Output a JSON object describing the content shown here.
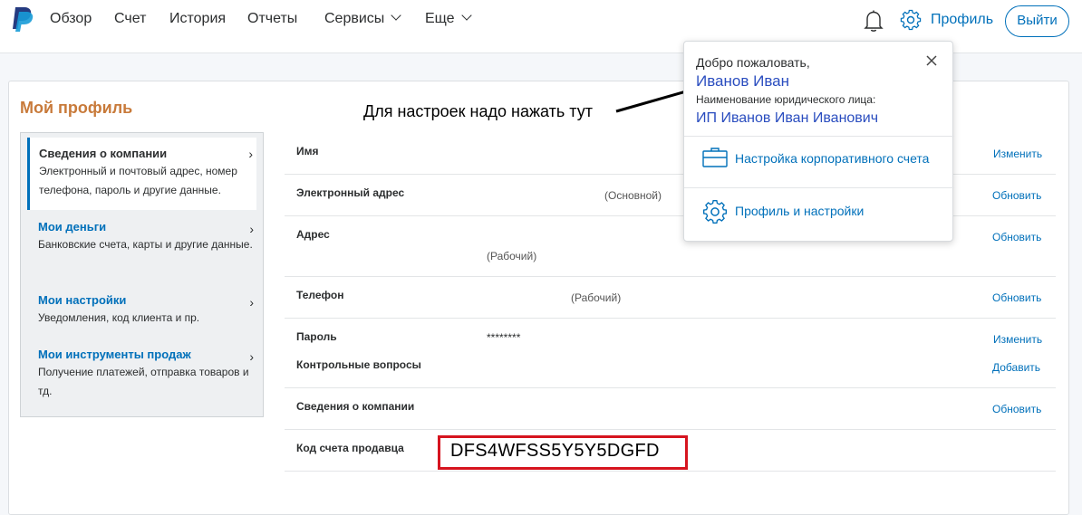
{
  "nav": {
    "items": [
      {
        "label": "Обзор"
      },
      {
        "label": "Счет"
      },
      {
        "label": "История"
      },
      {
        "label": "Отчеты"
      },
      {
        "label": "Сервисы"
      },
      {
        "label": "Еще"
      }
    ],
    "profile_label": "Профиль",
    "logout_label": "Выйти"
  },
  "page": {
    "title": "Мой профиль",
    "annotation": "Для настроек надо нажать тут"
  },
  "sidebar": {
    "items": [
      {
        "title": "Сведения о компании",
        "desc": "Электронный и почтовый адрес, номер телефона, пароль и другие данные."
      },
      {
        "title": "Мои деньги",
        "desc": "Банковские счета, карты и другие данные."
      },
      {
        "title": "Мои настройки",
        "desc": "Уведомления, код клиента и пр."
      },
      {
        "title": "Мои инструменты продаж",
        "desc": "Получение платежей, отправка товаров и тд."
      }
    ]
  },
  "rows": {
    "name": {
      "label": "Имя",
      "action": "Изменить"
    },
    "email": {
      "label": "Электронный адрес",
      "note": "(Основной)",
      "action": "Обновить"
    },
    "address": {
      "label": "Адрес",
      "note": "(Рабочий)",
      "action": "Обновить"
    },
    "phone": {
      "label": "Телефон",
      "note": "(Рабочий)",
      "action": "Обновить"
    },
    "password": {
      "label": "Пароль",
      "value": "********",
      "action": "Изменить"
    },
    "security": {
      "label": "Контрольные вопросы",
      "action": "Добавить"
    },
    "company": {
      "label": "Сведения о компании",
      "action": "Обновить"
    },
    "merchant": {
      "label": "Код счета продавца",
      "value": "DFS4WFSS5Y5Y5DGFD"
    }
  },
  "dropdown": {
    "welcome": "Добро пожаловать,",
    "name": "Иванов Иван",
    "entity_label": "Наименование юридического лица:",
    "entity": "ИП Иванов Иван Иванович",
    "items": [
      {
        "label": "Настройка корпоративного счета",
        "icon": "briefcase-icon"
      },
      {
        "label": "Профиль и настройки",
        "icon": "gear-icon"
      }
    ]
  },
  "colors": {
    "link": "#0070ba",
    "title_orange": "#c87a3a",
    "highlight_red": "#d6141f"
  }
}
